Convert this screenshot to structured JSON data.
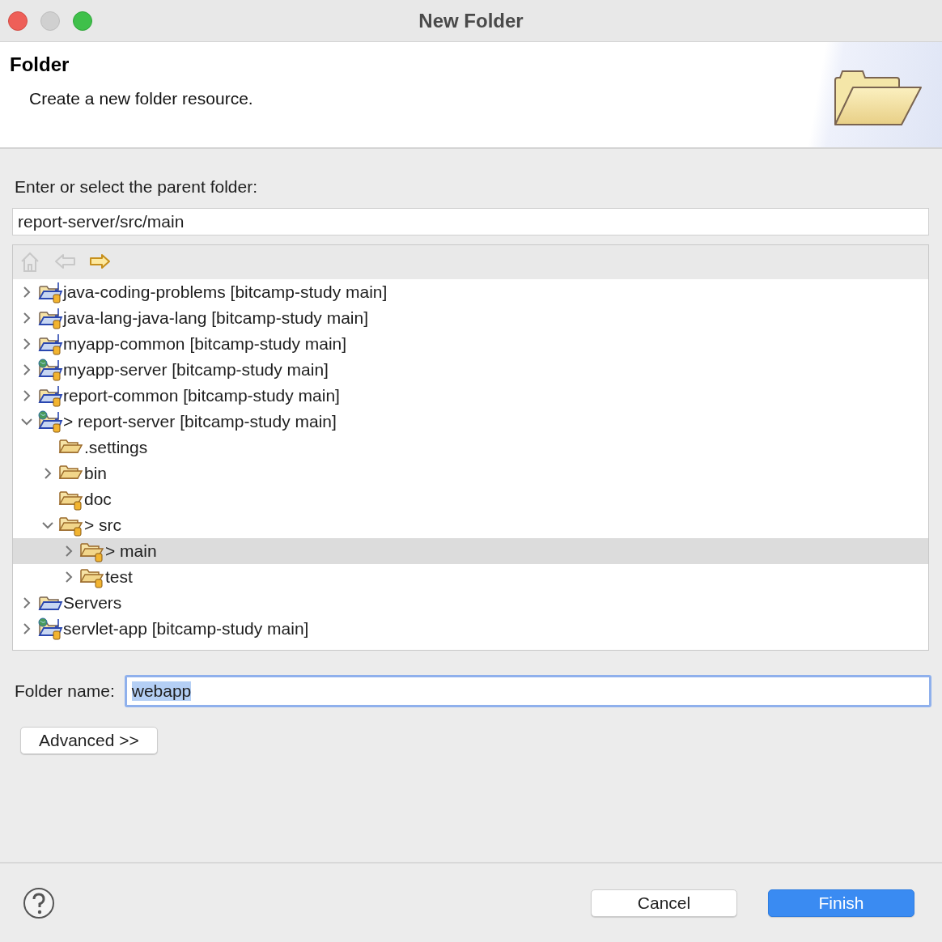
{
  "window": {
    "title": "New Folder"
  },
  "header": {
    "title": "Folder",
    "description": "Create a new folder resource."
  },
  "parent_folder": {
    "label": "Enter or select the parent folder:",
    "value": "report-server/src/main"
  },
  "tree_toolbar": [
    {
      "kind": "home",
      "disabled": true
    },
    {
      "kind": "back",
      "disabled": true
    },
    {
      "kind": "forward",
      "disabled": false
    }
  ],
  "tree": [
    {
      "label": "java-coding-problems [bitcamp-study main]",
      "kind": "java-project",
      "expanded": false,
      "selected": false
    },
    {
      "label": "java-lang-java-lang [bitcamp-study main]",
      "kind": "java-project",
      "expanded": false,
      "selected": false
    },
    {
      "label": "myapp-common [bitcamp-study main]",
      "kind": "java-project",
      "expanded": false,
      "selected": false
    },
    {
      "label": "myapp-server [bitcamp-study main]",
      "kind": "web-project",
      "expanded": false,
      "selected": false
    },
    {
      "label": "report-common [bitcamp-study main]",
      "kind": "java-project",
      "expanded": false,
      "selected": false
    },
    {
      "label": "> report-server [bitcamp-study main]",
      "kind": "web-project",
      "expanded": true,
      "selected": false,
      "children": [
        {
          "label": ".settings",
          "kind": "folder",
          "selected": false
        },
        {
          "label": "bin",
          "kind": "folder",
          "expanded": false,
          "selected": false
        },
        {
          "label": "doc",
          "kind": "tracked-folder",
          "selected": false
        },
        {
          "label": "> src",
          "kind": "tracked-folder",
          "expanded": true,
          "selected": false,
          "children": [
            {
              "label": "> main",
              "kind": "tracked-folder",
              "expanded": false,
              "selected": true
            },
            {
              "label": "test",
              "kind": "tracked-folder",
              "expanded": false,
              "selected": false
            }
          ]
        }
      ]
    },
    {
      "label": "Servers",
      "kind": "plain-project",
      "expanded": false,
      "selected": false
    },
    {
      "label": "servlet-app [bitcamp-study main]",
      "kind": "web-project",
      "expanded": false,
      "selected": false
    }
  ],
  "folder_name": {
    "label": "Folder name:",
    "value": "webapp",
    "text_selected": true
  },
  "advanced_button": "Advanced >>",
  "footer": {
    "buttons": [
      {
        "label": "Cancel",
        "default": false
      },
      {
        "label": "Finish",
        "default": true
      }
    ]
  }
}
